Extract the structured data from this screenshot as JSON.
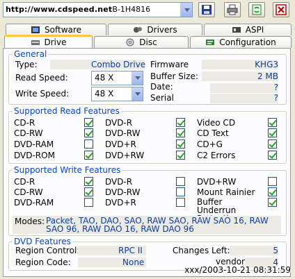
{
  "toolbar": {
    "drive_watermark": "http://www.cdspeed.net",
    "drive_suffix": "B-1H4816",
    "icons": [
      "save-icon",
      "print-icon",
      "refresh-icon",
      "exit-icon"
    ]
  },
  "tabs_top": [
    "Software",
    "Drivers",
    "ASPI"
  ],
  "tabs_bottom": [
    "Drive",
    "Disc",
    "Configuration"
  ],
  "general": {
    "title": "General",
    "type_label": "Type:",
    "type_value": "Combo Drive",
    "read_speed_label": "Read Speed:",
    "read_speed_value": "48 X",
    "write_speed_label": "Write Speed:",
    "write_speed_value": "48 X",
    "firmware_label": "Firmware",
    "firmware_value": "KHG3",
    "buffer_label": "Buffer Size:",
    "buffer_value": "2 MB",
    "date_label": "Date:",
    "date_value": "?",
    "serial_label": "Serial",
    "serial_value": "?"
  },
  "read_features": {
    "title": "Supported Read Features",
    "items": [
      {
        "label": "CD-R",
        "checked": true
      },
      {
        "label": "CD-RW",
        "checked": true
      },
      {
        "label": "DVD-RAM",
        "checked": false
      },
      {
        "label": "DVD-ROM",
        "checked": true
      },
      {
        "label": "DVD-R",
        "checked": true
      },
      {
        "label": "DVD-RW",
        "checked": true
      },
      {
        "label": "DVD+R",
        "checked": true
      },
      {
        "label": "DVD+RW",
        "checked": true
      },
      {
        "label": "Video CD",
        "checked": true
      },
      {
        "label": "CD Text",
        "checked": true
      },
      {
        "label": "CD+G",
        "checked": true
      },
      {
        "label": "C2 Errors",
        "checked": true
      }
    ]
  },
  "write_features": {
    "title": "Supported Write Features",
    "items": [
      {
        "label": "CD-R",
        "checked": true
      },
      {
        "label": "CD-RW",
        "checked": true
      },
      {
        "label": "DVD-RAM",
        "checked": false
      },
      {
        "label": "DVD-R",
        "checked": false
      },
      {
        "label": "DVD-RW",
        "checked": false
      },
      {
        "label": "DVD+R",
        "checked": false
      },
      {
        "label": "DVD+RW",
        "checked": false
      },
      {
        "label": "Mount Rainier",
        "checked": true
      },
      {
        "label": "Buffer Underrun Protection",
        "checked": true
      }
    ],
    "modes_label": "Modes:",
    "modes_value": "Packet, TAO, DAO, SAO, RAW SAO, RAW SAO 16, RAW SAO 96, RAW DAO 16, RAW DAO 96"
  },
  "dvd_features": {
    "title": "DVD Features",
    "region_control_label": "Region Control:",
    "region_control_value": "RPC II",
    "region_code_label": "Region Code:",
    "region_code_value": "None",
    "changes_left_label": "Changes Left:",
    "changes_left_value": "5",
    "vendor_label": "vendor:",
    "vendor_value": "4"
  },
  "timestamp": "xxx/2003-10-21 08:31:59",
  "colors": {
    "accent": "#0046d5",
    "value": "#0a3d9e",
    "check": "#21a121",
    "tab_highlight": "#ffc83c"
  }
}
